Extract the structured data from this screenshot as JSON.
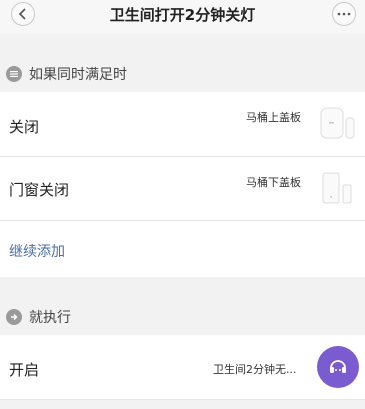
{
  "header": {
    "title": "卫生间打开2分钟关灯",
    "back_icon": "chevron-left-icon",
    "more_icon": "ellipsis-icon"
  },
  "conditions": {
    "section_label": "如果同时满足时",
    "section_icon": "list-icon",
    "items": [
      {
        "label": "关闭",
        "device": "马桶上盖板",
        "icon": "door-sensor-icon"
      },
      {
        "label": "门窗关闭",
        "device": "马桶下盖板",
        "icon": "door-sensor-icon"
      }
    ],
    "add_label": "继续添加"
  },
  "actions": {
    "section_label": "就执行",
    "section_icon": "arrow-right-icon",
    "items": [
      {
        "label": "开启",
        "device": "卫生间2分钟无...",
        "icon": "scene-icon",
        "icon_color": "#7a5cd0"
      }
    ]
  },
  "colors": {
    "background": "#f2f2f2",
    "link": "#4a6fa5",
    "accent": "#7a5cd0"
  }
}
